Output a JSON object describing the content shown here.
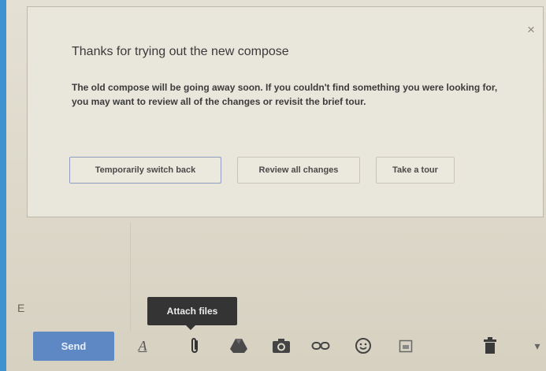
{
  "notice": {
    "title": "Thanks for trying out the new compose",
    "body": "The old compose will be going away soon. If you couldn't find something you were looking for, you may want to review all of the changes or revisit the brief tour.",
    "close_glyph": "×",
    "buttons": {
      "switch_back": "Temporarily switch back",
      "review_changes": "Review all changes",
      "take_tour": "Take a tour"
    }
  },
  "toolbar": {
    "send_label": "Send",
    "format_glyph": "A",
    "more_glyph": "▾",
    "icons": [
      "formatting-icon",
      "paperclip-icon",
      "drive-icon",
      "camera-icon",
      "link-icon",
      "emoji-icon",
      "calendar-icon",
      "trash-icon",
      "chevron-down-icon"
    ]
  },
  "tooltip": {
    "text": "Attach files"
  },
  "stray_char": "E",
  "colors": {
    "accent": "#3e92d0",
    "send_button": "#5d88c4",
    "tooltip_bg": "#343434"
  }
}
